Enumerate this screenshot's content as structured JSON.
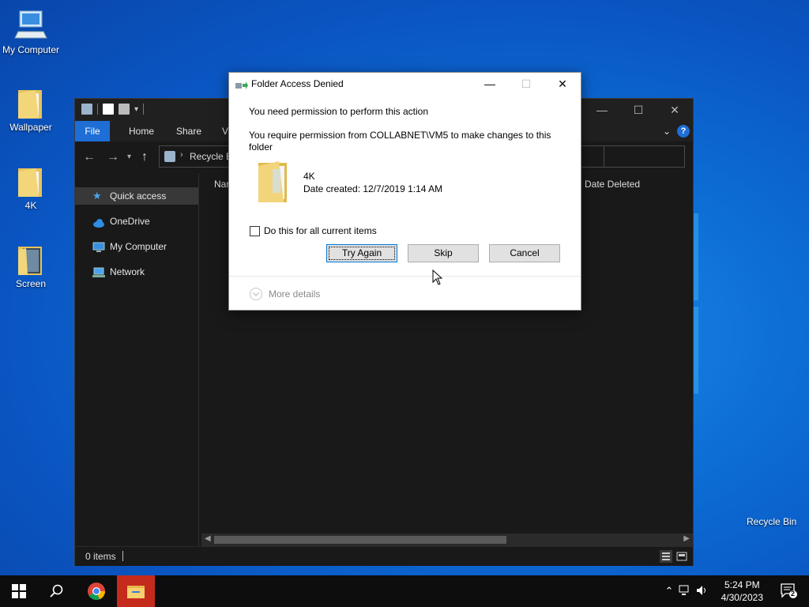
{
  "desktop": {
    "icons": [
      {
        "label": "My Computer"
      },
      {
        "label": "Wallpaper"
      },
      {
        "label": "4K"
      },
      {
        "label": "Screen"
      }
    ],
    "recycle_bin_label": "Recycle Bin"
  },
  "explorer": {
    "ribbon_tabs": [
      "File",
      "Home",
      "Share",
      "V"
    ],
    "address_text": "Recycle B",
    "nav_items": [
      "Quick access",
      "OneDrive",
      "My Computer",
      "Network"
    ],
    "columns": {
      "name": "Nar",
      "date_deleted": "Date Deleted"
    },
    "status": {
      "item_count": "0 items"
    },
    "help_symbol": "?"
  },
  "dialog": {
    "title": "Folder Access Denied",
    "heading": "You need permission to perform this action",
    "message": "You require permission from COLLABNET\\VM5 to make changes to this folder",
    "item": {
      "name": "4K",
      "date_created": "Date created: 12/7/2019 1:14 AM"
    },
    "checkbox_label": "Do this for all current items",
    "checkbox_checked": false,
    "buttons": {
      "try_again": "Try Again",
      "skip": "Skip",
      "cancel": "Cancel"
    },
    "more_details": "More details"
  },
  "taskbar": {
    "time": "5:24 PM",
    "date": "4/30/2023",
    "notification_count": "2",
    "accent_color": "#c42b1c"
  },
  "colors": {
    "desktop": "#0d6fd6",
    "explorer_bg": "#191919",
    "file_tab": "#1e6ed6",
    "dialog_bg": "#ffffff"
  }
}
